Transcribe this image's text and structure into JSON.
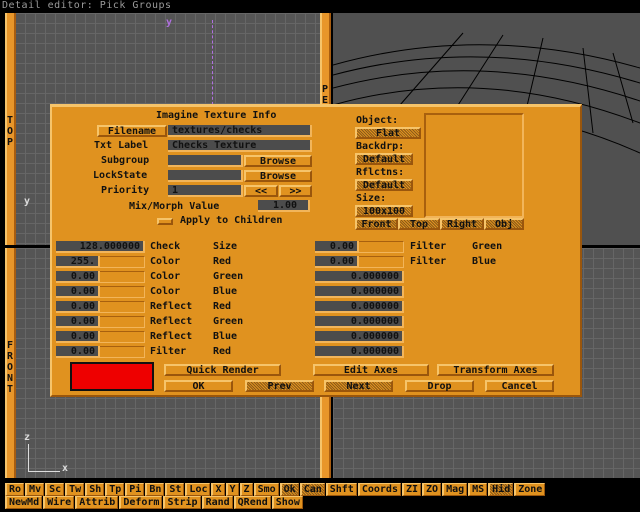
{
  "window": {
    "title": "Detail editor: Pick Groups"
  },
  "viewports": {
    "top_label": "TOP",
    "front_label": "FRONT",
    "persp_label": "PE",
    "axis_y": "y",
    "axis_z": "z",
    "axis_x": "x"
  },
  "dialog": {
    "title": "Imagine Texture Info",
    "filename_button": "Filename",
    "filename_value": "textures/checks",
    "txt_label": "Txt Label",
    "txt_label_value": "Checks Texture",
    "subgroup_label": "Subgroup",
    "subgroup_value": "",
    "browse": "Browse",
    "lockstate_label": "LockState",
    "lockstate_value": "",
    "priority_label": "Priority",
    "priority_value": "1",
    "prev_priority": "<<",
    "next_priority": ">>",
    "mix_label": "Mix/Morph Value",
    "mix_value": "1.00",
    "apply_children": "Apply to Children",
    "apply_children_checked": false,
    "object_label": "Object:",
    "object_value": "Flat",
    "backdrop_label": "Backdrp:",
    "backdrop_value": "Default",
    "reflections_label": "Rflctns:",
    "reflections_value": "Default",
    "size_label": "Size:",
    "size_value": "100x100",
    "view_buttons": [
      "Front",
      "Top",
      "Right",
      "Obj"
    ],
    "params_left": [
      {
        "value": "128.000000",
        "name1": "Check",
        "name2": "Size",
        "full": true
      },
      {
        "value": "255.",
        "name1": "Color",
        "name2": "Red"
      },
      {
        "value": "0.00",
        "name1": "Color",
        "name2": "Green"
      },
      {
        "value": "0.00",
        "name1": "Color",
        "name2": "Blue"
      },
      {
        "value": "0.00",
        "name1": "Reflect",
        "name2": "Red"
      },
      {
        "value": "0.00",
        "name1": "Reflect",
        "name2": "Green"
      },
      {
        "value": "0.00",
        "name1": "Reflect",
        "name2": "Blue"
      },
      {
        "value": "0.00",
        "name1": "Filter",
        "name2": "Red"
      }
    ],
    "params_right": [
      {
        "value": "0.00",
        "name1": "Filter",
        "name2": "Green"
      },
      {
        "value": "0.00",
        "name1": "Filter",
        "name2": "Blue"
      },
      {
        "value": "0.000000",
        "full": true
      },
      {
        "value": "0.000000",
        "full": true
      },
      {
        "value": "0.000000",
        "full": true
      },
      {
        "value": "0.000000",
        "full": true
      },
      {
        "value": "0.000000",
        "full": true
      },
      {
        "value": "0.000000",
        "full": true
      }
    ],
    "swatch_color": "#ee0000",
    "quick_render": "Quick Render",
    "edit_axes": "Edit Axes",
    "transform_axes": "Transform Axes",
    "ok": "OK",
    "prev": "Prev",
    "next": "Next",
    "drop": "Drop",
    "cancel": "Cancel"
  },
  "toolbar": {
    "row1": [
      "Ro",
      "Mv",
      "Sc",
      "Tw",
      "Sh",
      "Tp",
      "Pi",
      "Bn",
      "St",
      "Loc",
      "X",
      "Y",
      "Z",
      "Smo",
      "Ok",
      "Can",
      "Shft",
      "Coords",
      "ZI",
      "ZO",
      "Mag",
      "MS",
      "Hid",
      "Zone"
    ],
    "row1_dithered": [
      "Ok",
      "Can",
      "Hid"
    ],
    "row2": [
      "NewMd",
      "Wire",
      "Attrib",
      "Deform",
      "Strip",
      "Rand",
      "QRend",
      "Show"
    ]
  }
}
